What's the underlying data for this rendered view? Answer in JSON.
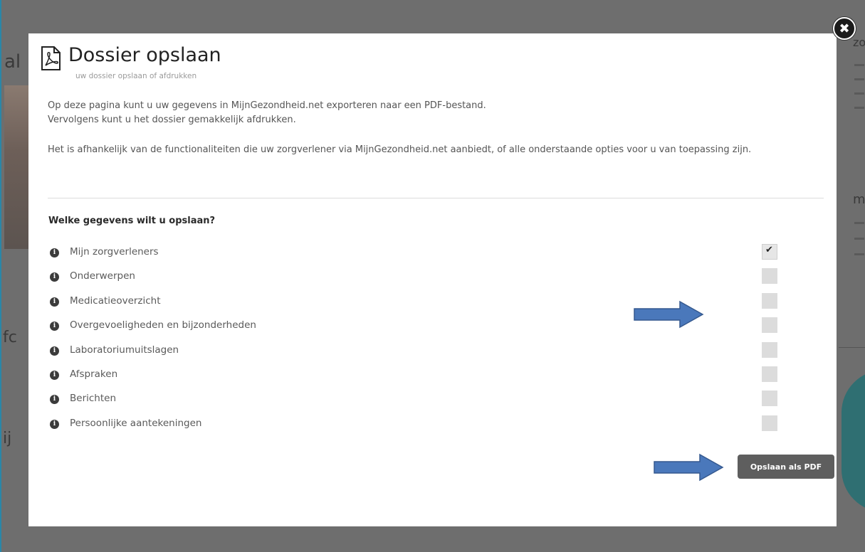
{
  "background": {
    "fragments": [
      "al",
      "fc",
      "ij",
      "zo",
      "m"
    ]
  },
  "modal": {
    "title": "Dossier opslaan",
    "subtitle": "uw dossier opslaan of afdrukken",
    "intro_line1": "Op deze pagina kunt u uw gegevens in MijnGezondheid.net exporteren naar een PDF-bestand.",
    "intro_line2": "Vervolgens kunt u het dossier gemakkelijk afdrukken.",
    "intro_line3": "Het is afhankelijk van de functionaliteiten die uw zorgverlener via MijnGezondheid.net aanbiedt, of alle onderstaande opties voor u van toepassing zijn.",
    "question": "Welke gegevens wilt u opslaan?",
    "options": [
      {
        "label": "Mijn zorgverleners",
        "checked": true
      },
      {
        "label": "Onderwerpen",
        "checked": false
      },
      {
        "label": "Medicatieoverzicht",
        "checked": false
      },
      {
        "label": "Overgevoeligheden en bijzonderheden",
        "checked": false
      },
      {
        "label": "Laboratoriumuitslagen",
        "checked": false
      },
      {
        "label": "Afspraken",
        "checked": false
      },
      {
        "label": "Berichten",
        "checked": false
      },
      {
        "label": "Persoonlijke aantekeningen",
        "checked": false
      }
    ],
    "checkmark_glyph": "✔",
    "info_glyph": "i",
    "close_glyph": "✖",
    "save_button": "Opslaan als PDF"
  },
  "icons": {
    "pdf": "pdf-file-icon",
    "info": "info-circle-icon",
    "close": "close-icon",
    "arrow": "arrow-right-icon"
  },
  "colors": {
    "arrow_fill": "#4a78bb",
    "arrow_stroke": "#35598f",
    "button_bg": "#5e5e5e",
    "overlay": "#6e6e6e"
  }
}
